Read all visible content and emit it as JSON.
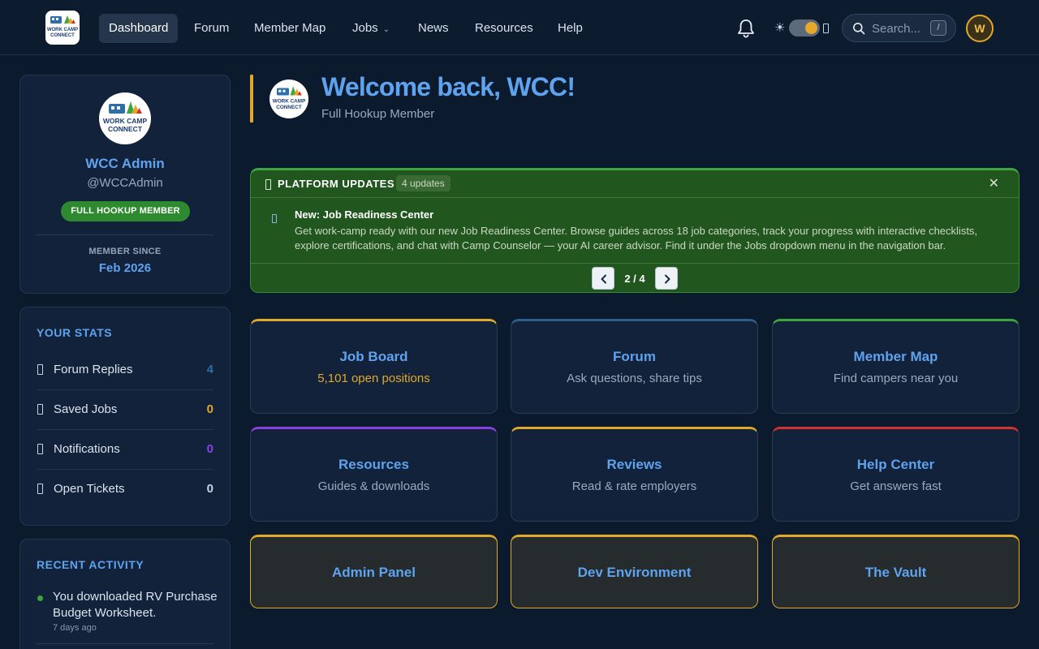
{
  "nav": {
    "logo_text": "WORK CAMP CONNECT",
    "links": [
      {
        "label": "Dashboard",
        "active": true
      },
      {
        "label": "Forum"
      },
      {
        "label": "Member Map"
      },
      {
        "label": "Jobs",
        "dropdown": true
      },
      {
        "label": "News"
      },
      {
        "label": "Resources"
      },
      {
        "label": "Help"
      }
    ],
    "search_placeholder": "Search...",
    "search_shortcut": "/",
    "sun_glyph": "☀",
    "avatar_initial": "W"
  },
  "profile": {
    "name": "WCC Admin",
    "handle": "@WCCAdmin",
    "badge": "FULL HOOKUP MEMBER",
    "member_since_label": "MEMBER SINCE",
    "member_since": "Feb 2026"
  },
  "stats": {
    "title": "YOUR STATS",
    "items": [
      {
        "label": "Forum Replies",
        "value": "4",
        "color": "#2f6fa8"
      },
      {
        "label": "Saved Jobs",
        "value": "0",
        "color": "#e0a92a"
      },
      {
        "label": "Notifications",
        "value": "0",
        "color": "#8a3fe0"
      },
      {
        "label": "Open Tickets",
        "value": "0",
        "color": "#c9d4e2"
      }
    ]
  },
  "activity": {
    "title": "RECENT ACTIVITY",
    "items": [
      {
        "text": "You downloaded RV Purchase Budget Worksheet.",
        "time": "7 days ago"
      }
    ]
  },
  "welcome": {
    "title": "Welcome back, WCC!",
    "subtitle": "Full Hookup Member"
  },
  "updates": {
    "title": "PLATFORM UPDATES",
    "count": "4 updates",
    "close_glyph": "✕",
    "current": {
      "title": "New: Job Readiness Center",
      "body": "Get work-camp ready with our new Job Readiness Center. Browse guides across 18 job categories, track your progress with interactive checklists, explore certifications, and chat with Camp Counselor — your AI career advisor. Find it under the Jobs dropdown menu in the navigation bar."
    },
    "page": "2 / 4"
  },
  "tiles": [
    {
      "title": "Job Board",
      "subtitle": "5,101 open positions",
      "accent": "#e0a92a",
      "sub_color": "#e0a92a"
    },
    {
      "title": "Forum",
      "subtitle": "Ask questions, share tips",
      "accent": "#2f5f88"
    },
    {
      "title": "Member Map",
      "subtitle": "Find campers near you",
      "accent": "#3ea63e"
    },
    {
      "title": "Resources",
      "subtitle": "Guides & downloads",
      "accent": "#8a3fe0"
    },
    {
      "title": "Reviews",
      "subtitle": "Read & rate employers",
      "accent": "#e0a92a"
    },
    {
      "title": "Help Center",
      "subtitle": "Get answers fast",
      "accent": "#d63030"
    }
  ],
  "admin_tiles": [
    {
      "title": "Admin Panel"
    },
    {
      "title": "Dev Environment"
    },
    {
      "title": "The Vault"
    }
  ],
  "colors": {
    "accent_blue": "#5fa2ee",
    "gold": "#e0a92a",
    "green": "#3ea63e"
  }
}
